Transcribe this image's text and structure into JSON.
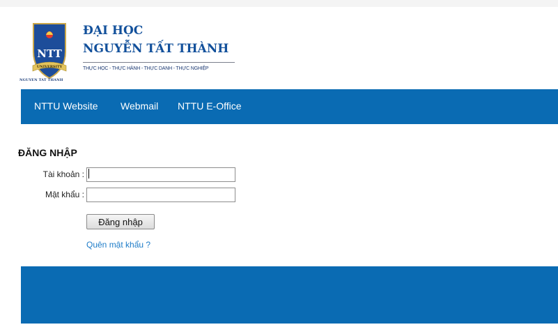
{
  "header": {
    "university_line1": "ĐẠI HỌC",
    "university_line2": "NGUYỄN TẤT THÀNH",
    "motto": "THỰC HỌC - THỰC HÀNH - THỰC DANH - THỰC NGHIỆP",
    "logo_caption": "NGUYEN TAT THANH",
    "logo_ribbon": "UNIVERSITY",
    "logo_monogram": "NTT"
  },
  "nav": {
    "items": [
      {
        "label": "NTTU Website"
      },
      {
        "label": "Webmail"
      },
      {
        "label": "NTTU E-Office"
      }
    ]
  },
  "login": {
    "title": "ĐĂNG NHẬP",
    "username_label": "Tài khoản :",
    "username_value": "",
    "password_label": "Mật khẩu :",
    "password_value": "",
    "submit_label": "Đăng nhập",
    "forgot_label": "Quên mật khẩu ?"
  },
  "colors": {
    "brand_blue": "#0a6bb3",
    "title_blue": "#12509b",
    "link_blue": "#1e7cc8"
  }
}
